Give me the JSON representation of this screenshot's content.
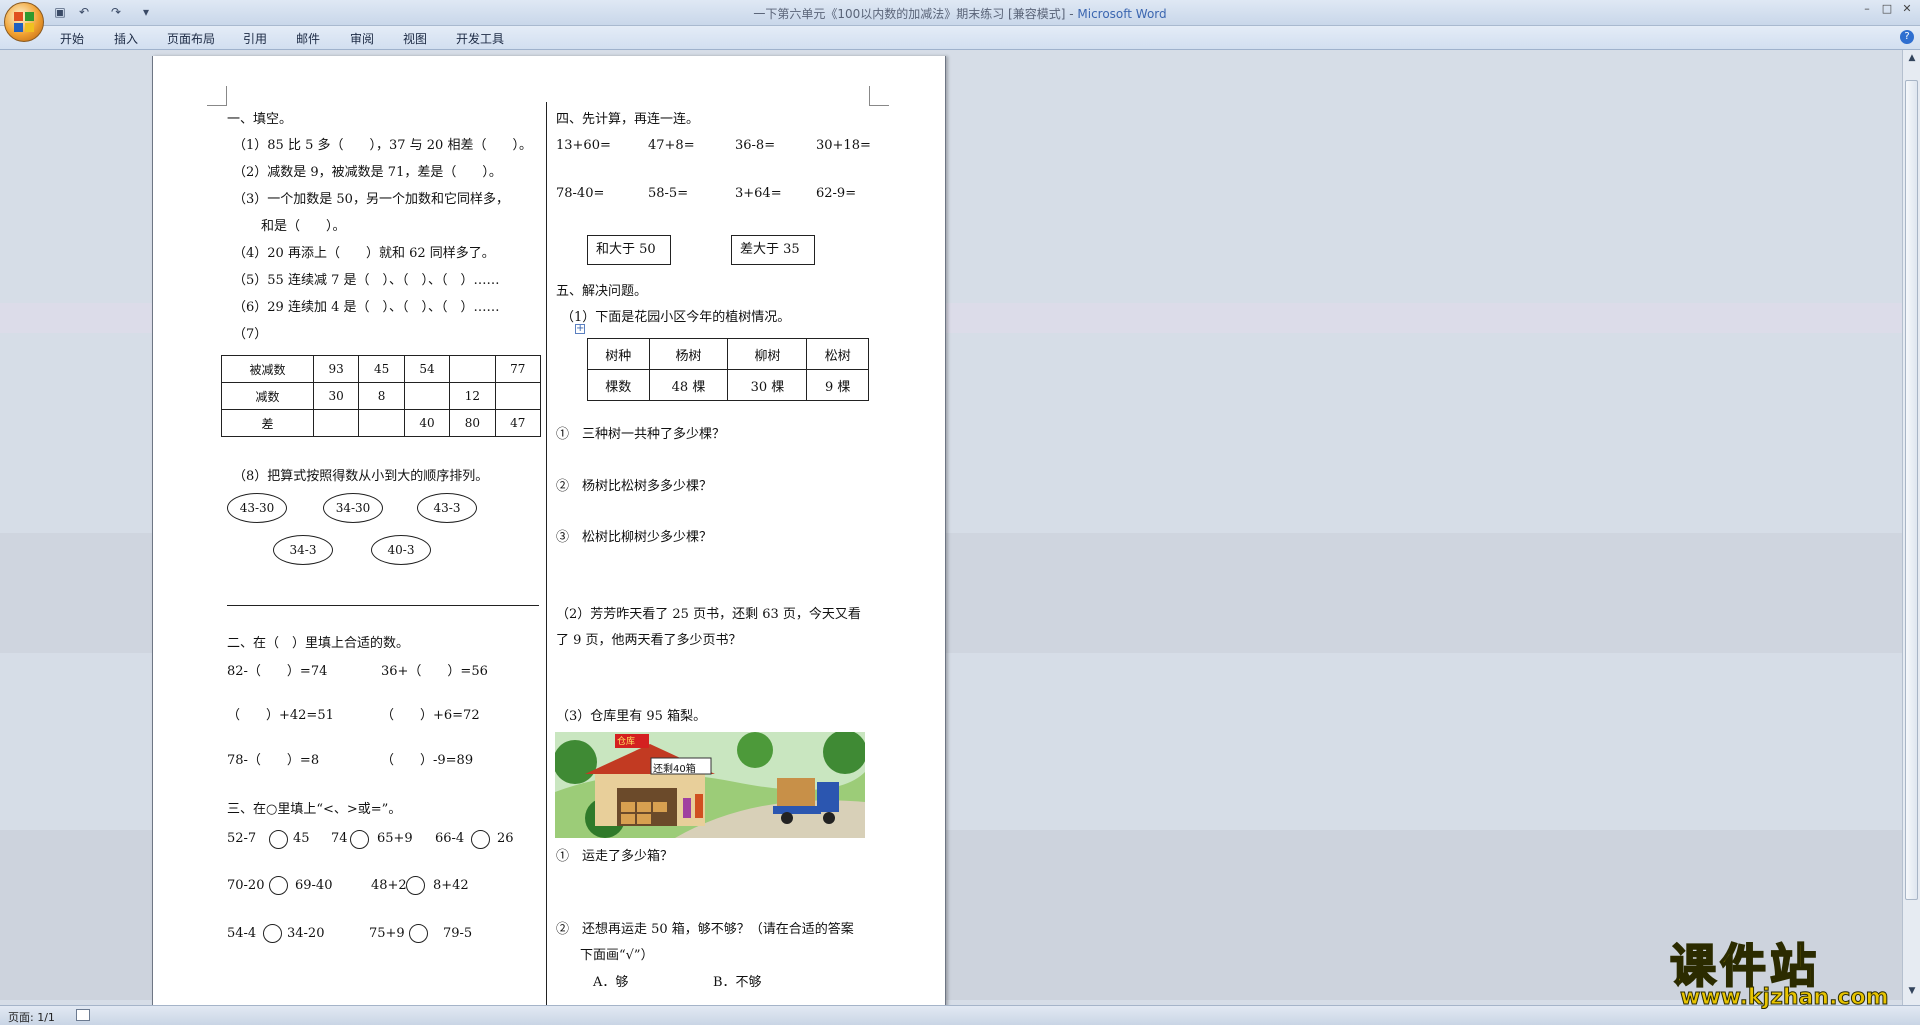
{
  "window": {
    "title_doc": "一下第六单元《100以内数的加减法》期末练习 [兼容模式] - ",
    "title_app": "Microsoft Word",
    "qat_icons": [
      "save-icon",
      "undo-icon",
      "redo-icon",
      "customize-icon"
    ],
    "minimize": "–",
    "maximize": "□",
    "close": "✕"
  },
  "ribbon": {
    "tabs": [
      "开始",
      "插入",
      "页面布局",
      "引用",
      "邮件",
      "审阅",
      "视图",
      "开发工具"
    ],
    "help": "?"
  },
  "status": {
    "page": "页面: 1/1"
  },
  "watermark": {
    "text": "课件站",
    "url": "www.kjzhan.com"
  },
  "doc": {
    "s1": {
      "title": "一、填空。",
      "q1": "（1）85 比 5 多（　　），37 与 20 相差（　　）。",
      "q2": "（2）减数是 9，被减数是 71，差是（　　）。",
      "q3a": "（3）一个加数是 50，另一个加数和它同样多，",
      "q3b": "和是（　　）。",
      "q4": "（4）20 再添上（　　）就和 62 同样多了。",
      "q5": "（5）55 连续减 7 是（　）、（　）、（　）……",
      "q6": "（6）29 连续加 4 是（　）、（　）、（　）……",
      "q7": "（7）",
      "table": {
        "rows": [
          {
            "label": "被减数",
            "cells": [
              "93",
              "45",
              "54",
              "",
              "77"
            ]
          },
          {
            "label": "减数",
            "cells": [
              "30",
              "8",
              "",
              "12",
              ""
            ]
          },
          {
            "label": "差",
            "cells": [
              "",
              "",
              "40",
              "80",
              "47"
            ]
          }
        ]
      },
      "q8": "（8）把算式按照得数从小到大的顺序排列。",
      "ovals": [
        "43-30",
        "34-30",
        "43-3",
        "34-3",
        "40-3"
      ]
    },
    "s2": {
      "title": "二、在（　）里填上合适的数。",
      "r1a": "82-（　　）=74",
      "r1b": "36+（　　）=56",
      "r2a": "（　　）+42=51",
      "r2b": "（　　）+6=72",
      "r3a": "78-（　　）=8",
      "r3b": "（　　）-9=89"
    },
    "s3": {
      "title": "三、在○里填上“<、>或=”。",
      "items": [
        {
          "a": "52-7",
          "b": "45"
        },
        {
          "a": "74",
          "b": "65+9"
        },
        {
          "a": "66-4",
          "b": "26"
        },
        {
          "a": "70-20",
          "b": "69-40"
        },
        {
          "a": "48+2",
          "b": "8+42"
        },
        {
          "a": "54-4",
          "b": "34-20"
        },
        {
          "a": "75+9",
          "b": "79-5"
        }
      ]
    },
    "s4": {
      "title": "四、先计算，再连一连。",
      "row1": [
        "13+60=",
        "47+8=",
        "36-8=",
        "30+18="
      ],
      "row2": [
        "78-40=",
        "58-5=",
        "3+64=",
        "62-9="
      ],
      "box1": "和大于 50",
      "box2": "差大于 35"
    },
    "s5": {
      "title": "五、解决问题。",
      "p1": "（1）下面是花园小区今年的植树情况。",
      "tree_header": [
        "树种",
        "杨树",
        "柳树",
        "松树"
      ],
      "tree_counts": [
        "棵数",
        "48 棵",
        "30 棵",
        "9 棵"
      ],
      "p1q1": "①　三种树一共种了多少棵？",
      "p1q2": "②　杨树比松树多多少棵？",
      "p1q3": "③　松树比柳树少多少棵？",
      "p2a": "（2）芳芳昨天看了 25 页书，还剩 63 页，今天又看",
      "p2b": "了 9 页，他两天看了多少页书？",
      "p3": "（3）仓库里有 95 箱梨。",
      "warehouse": "仓库",
      "sign": "还剩40箱",
      "p3q1": "①　运走了多少箱？",
      "p3q2a": "②　还想再运走 50 箱，够不够？（请在合适的答案",
      "p3q2b": "下面画“√”）",
      "optA": "A．够",
      "optB": "B．不够"
    }
  }
}
